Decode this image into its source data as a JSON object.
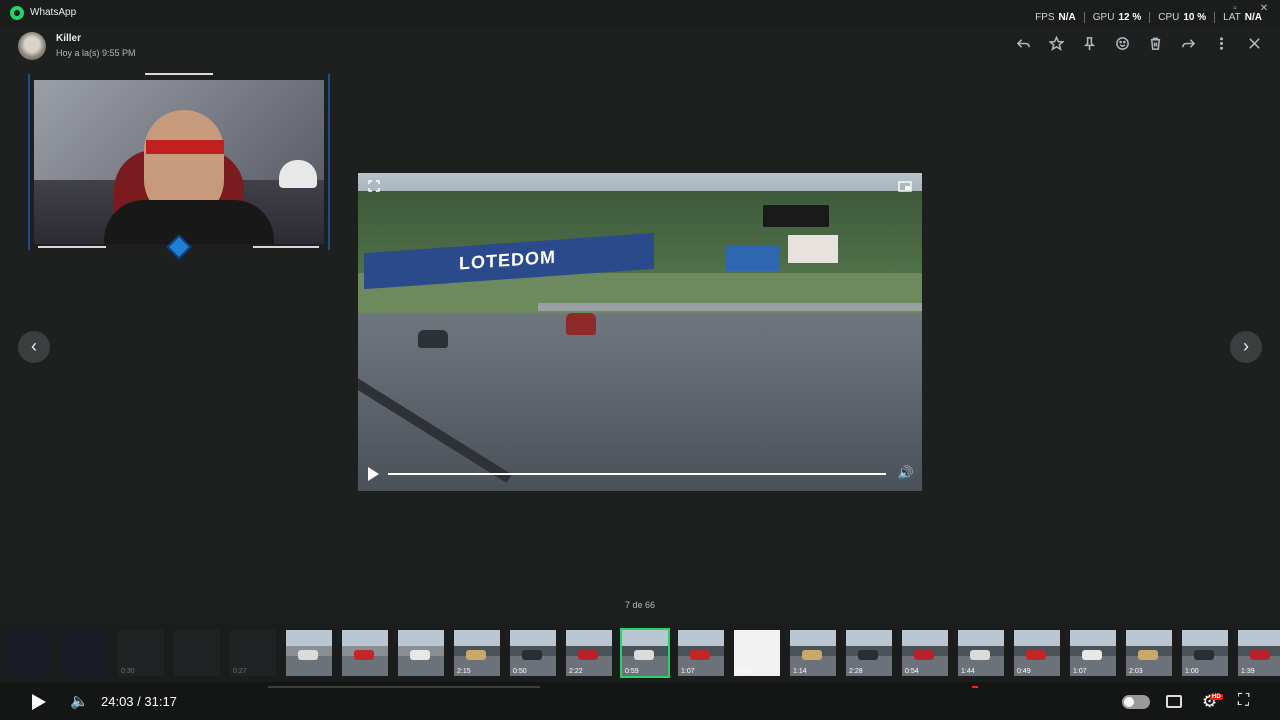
{
  "app": {
    "title": "WhatsApp"
  },
  "stats": [
    {
      "label": "FPS",
      "value": "N/A"
    },
    {
      "label": "GPU",
      "value": "12 %"
    },
    {
      "label": "CPU",
      "value": "10 %"
    },
    {
      "label": "LAT",
      "value": "N/A"
    }
  ],
  "header": {
    "contact": "Killer",
    "timestamp": "Hoy a la(s) 9:55 PM"
  },
  "header_icons": [
    "reply-icon",
    "star-icon",
    "pin-icon",
    "emoji-icon",
    "delete-icon",
    "forward-icon",
    "more-icon",
    "close-icon"
  ],
  "video": {
    "banner_text": "LOTEDOM"
  },
  "counter": "7 de 66",
  "thumbnails": [
    {
      "duration": "",
      "kind": "dark"
    },
    {
      "duration": "",
      "kind": "dark"
    },
    {
      "duration": "0:30",
      "kind": "dim"
    },
    {
      "duration": "",
      "kind": "dim"
    },
    {
      "duration": "0:27",
      "kind": "dim"
    },
    {
      "duration": "",
      "kind": "photo"
    },
    {
      "duration": "",
      "kind": "photo"
    },
    {
      "duration": "",
      "kind": "photo"
    },
    {
      "duration": "2:15",
      "kind": "video"
    },
    {
      "duration": "0:50",
      "kind": "video"
    },
    {
      "duration": "2:22",
      "kind": "video"
    },
    {
      "duration": "0:59",
      "kind": "video",
      "selected": true
    },
    {
      "duration": "1:07",
      "kind": "video"
    },
    {
      "duration": "0:33",
      "kind": "white"
    },
    {
      "duration": "1:14",
      "kind": "video"
    },
    {
      "duration": "2:28",
      "kind": "video"
    },
    {
      "duration": "0:54",
      "kind": "video"
    },
    {
      "duration": "1:44",
      "kind": "video"
    },
    {
      "duration": "0:49",
      "kind": "video"
    },
    {
      "duration": "1:07",
      "kind": "video"
    },
    {
      "duration": "2:03",
      "kind": "video"
    },
    {
      "duration": "1:00",
      "kind": "video"
    },
    {
      "duration": "1:39",
      "kind": "video"
    }
  ],
  "player": {
    "time": "24:03 / 31:17",
    "hd_badge": "HD"
  },
  "colors": {
    "accent": "#25d366",
    "background": "#1e1f1f"
  }
}
